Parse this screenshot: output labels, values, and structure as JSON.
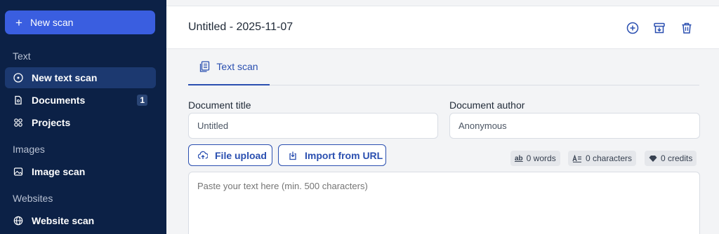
{
  "sidebar": {
    "new_scan_label": "New scan",
    "sections": {
      "text": "Text",
      "images": "Images",
      "websites": "Websites"
    },
    "items": [
      {
        "label": "New text scan",
        "icon": "circle-plus-icon",
        "active": true
      },
      {
        "label": "Documents",
        "icon": "document-icon",
        "badge": "1"
      },
      {
        "label": "Projects",
        "icon": "grid-icon"
      },
      {
        "label": "Image scan",
        "icon": "image-icon"
      },
      {
        "label": "Website scan",
        "icon": "globe-icon"
      }
    ]
  },
  "header": {
    "title": "Untitled - 2025-11-07",
    "actions": [
      "add-icon",
      "archive-icon",
      "trash-icon"
    ]
  },
  "tabs": [
    {
      "label": "Text scan",
      "icon": "clipboard-icon",
      "active": true
    }
  ],
  "form": {
    "title_label": "Document title",
    "title_value": "Untitled",
    "author_label": "Document author",
    "author_value": "Anonymous"
  },
  "actions": {
    "file_upload": "File upload",
    "import_url": "Import from URL"
  },
  "stats": {
    "words": "0 words",
    "characters": "0 characters",
    "credits": "0 credits"
  },
  "editor": {
    "placeholder": "Paste your text here (min. 500 characters)"
  },
  "colors": {
    "sidebar_bg": "#0c2146",
    "accent": "#3a5ee0",
    "primary_text": "#2a4fb0"
  }
}
